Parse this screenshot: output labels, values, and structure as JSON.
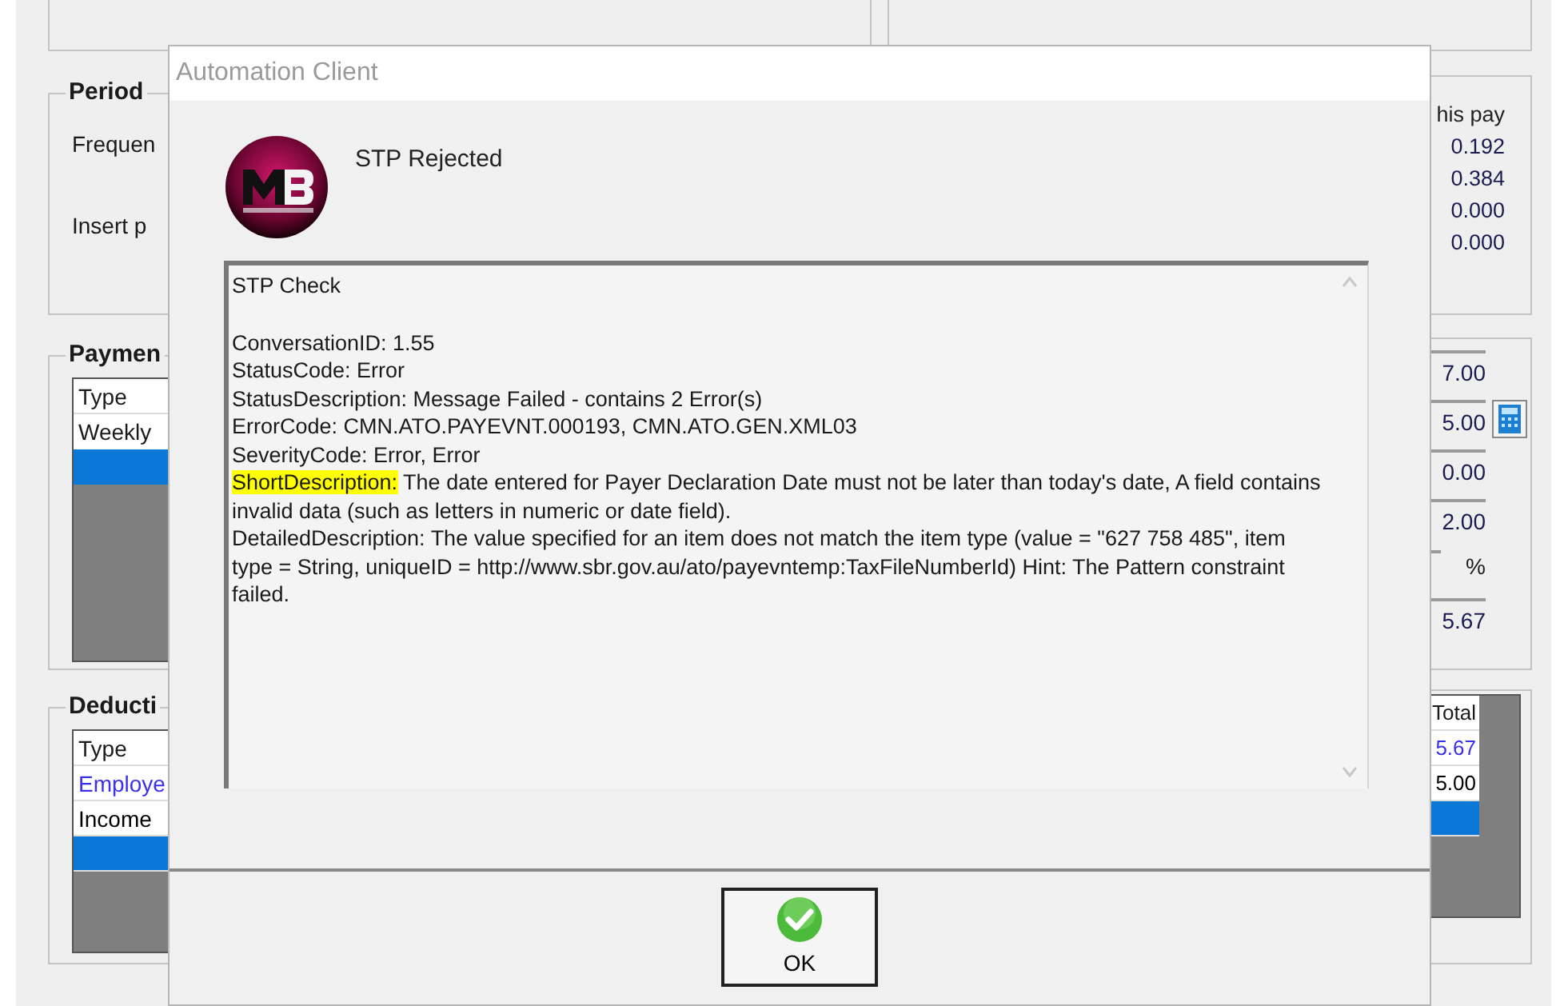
{
  "period": {
    "title": "Period",
    "labels": [
      "Frequen",
      "Insert p"
    ],
    "this_pay_header": "his pay",
    "this_pay_values": [
      "0.192",
      "0.384",
      "0.000",
      "0.000"
    ]
  },
  "payments": {
    "title": "Paymen",
    "type_header": "Type",
    "rows": [
      {
        "type": "Weekly",
        "selected": false
      },
      {
        "selected": true
      }
    ],
    "amounts": [
      {
        "kind": "value",
        "value": "7.00"
      },
      {
        "kind": "calculator",
        "value": "5.00"
      },
      {
        "kind": "value",
        "value": "0.00"
      },
      {
        "kind": "value",
        "value": "2.00"
      },
      {
        "kind": "percent",
        "unit": "%"
      },
      {
        "kind": "value",
        "value": "5.67"
      }
    ]
  },
  "deductions": {
    "title": "Deducti",
    "type_header": "Type",
    "total_header": "Total",
    "rows": [
      {
        "type": "Employe",
        "total": "5.67",
        "color": "#3b2ff0",
        "selected": false
      },
      {
        "type": "Income",
        "total": "5.00",
        "color": "#000000",
        "selected": false
      },
      {
        "selected": true
      }
    ]
  },
  "dialog": {
    "title": "Automation Client",
    "heading": "STP Rejected",
    "message": [
      {
        "text": "STP Check"
      },
      {
        "kind": "blank"
      },
      {
        "text": "ConversationID: 1.55"
      },
      {
        "text": "StatusCode: Error"
      },
      {
        "text": "StatusDescription: Message Failed - contains 2 Error(s)"
      },
      {
        "text": "ErrorCode: CMN.ATO.PAYEVNT.000193, CMN.ATO.GEN.XML03"
      },
      {
        "text": "SeverityCode: Error, Error"
      },
      {
        "label": "ShortDescription:",
        "highlighted": true,
        "text": " The date entered for Payer Declaration Date must not be later than today's date, A field contains invalid data (such as letters in numeric or date field)."
      },
      {
        "text": "DetailedDescription: The value specified for an item does not match the item type (value = \"627 758 485\", item type = String, uniqueID = http://www.sbr.gov.au/ato/payevntemp:TaxFileNumberId) Hint: The Pattern constraint failed."
      }
    ],
    "button": "OK"
  }
}
